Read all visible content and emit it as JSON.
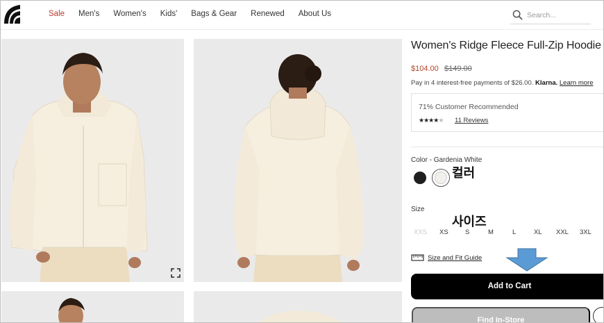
{
  "header": {
    "nav": [
      {
        "label": "Sale"
      },
      {
        "label": "Men's"
      },
      {
        "label": "Women's"
      },
      {
        "label": "Kids'"
      },
      {
        "label": "Bags & Gear"
      },
      {
        "label": "Renewed"
      },
      {
        "label": "About Us"
      }
    ],
    "search": {
      "placeholder": "Search..."
    }
  },
  "product": {
    "title": "Women's Ridge Fleece Full-Zip Hoodie",
    "price": "$104.00",
    "original_price": "$149.00",
    "klarna_text": "Pay in 4 interest-free payments of $26.00.",
    "klarna_brand": "Klarna.",
    "klarna_link": "Learn more",
    "recommendation": "71% Customer Recommended",
    "rating": 3.5,
    "reviews_link": "11 Reviews",
    "color_label": "Color - Gardenia White",
    "colors": [
      {
        "name": "black",
        "hex": "#1f1f1f"
      },
      {
        "name": "gardenia-white",
        "hex": "#f1f0ec",
        "selected": true
      }
    ],
    "size_label": "Size",
    "sizes": [
      {
        "label": "XXS",
        "available": false
      },
      {
        "label": "XS",
        "available": true
      },
      {
        "label": "S",
        "available": true
      },
      {
        "label": "M",
        "available": true
      },
      {
        "label": "L",
        "available": true
      },
      {
        "label": "XL",
        "available": true
      },
      {
        "label": "XXL",
        "available": true
      },
      {
        "label": "3XL",
        "available": true
      }
    ],
    "size_guide": "Size and Fit Guide",
    "add_to_cart": "Add to Cart",
    "find_in_store": "Find In-Store"
  },
  "annotations": {
    "color_note": "컬러",
    "size_note": "사이즈",
    "arrow_color": "#5b9bd5"
  },
  "colors": {
    "sale_red": "#c0392b",
    "price_red": "#b5432b",
    "cta_black": "#000000"
  }
}
